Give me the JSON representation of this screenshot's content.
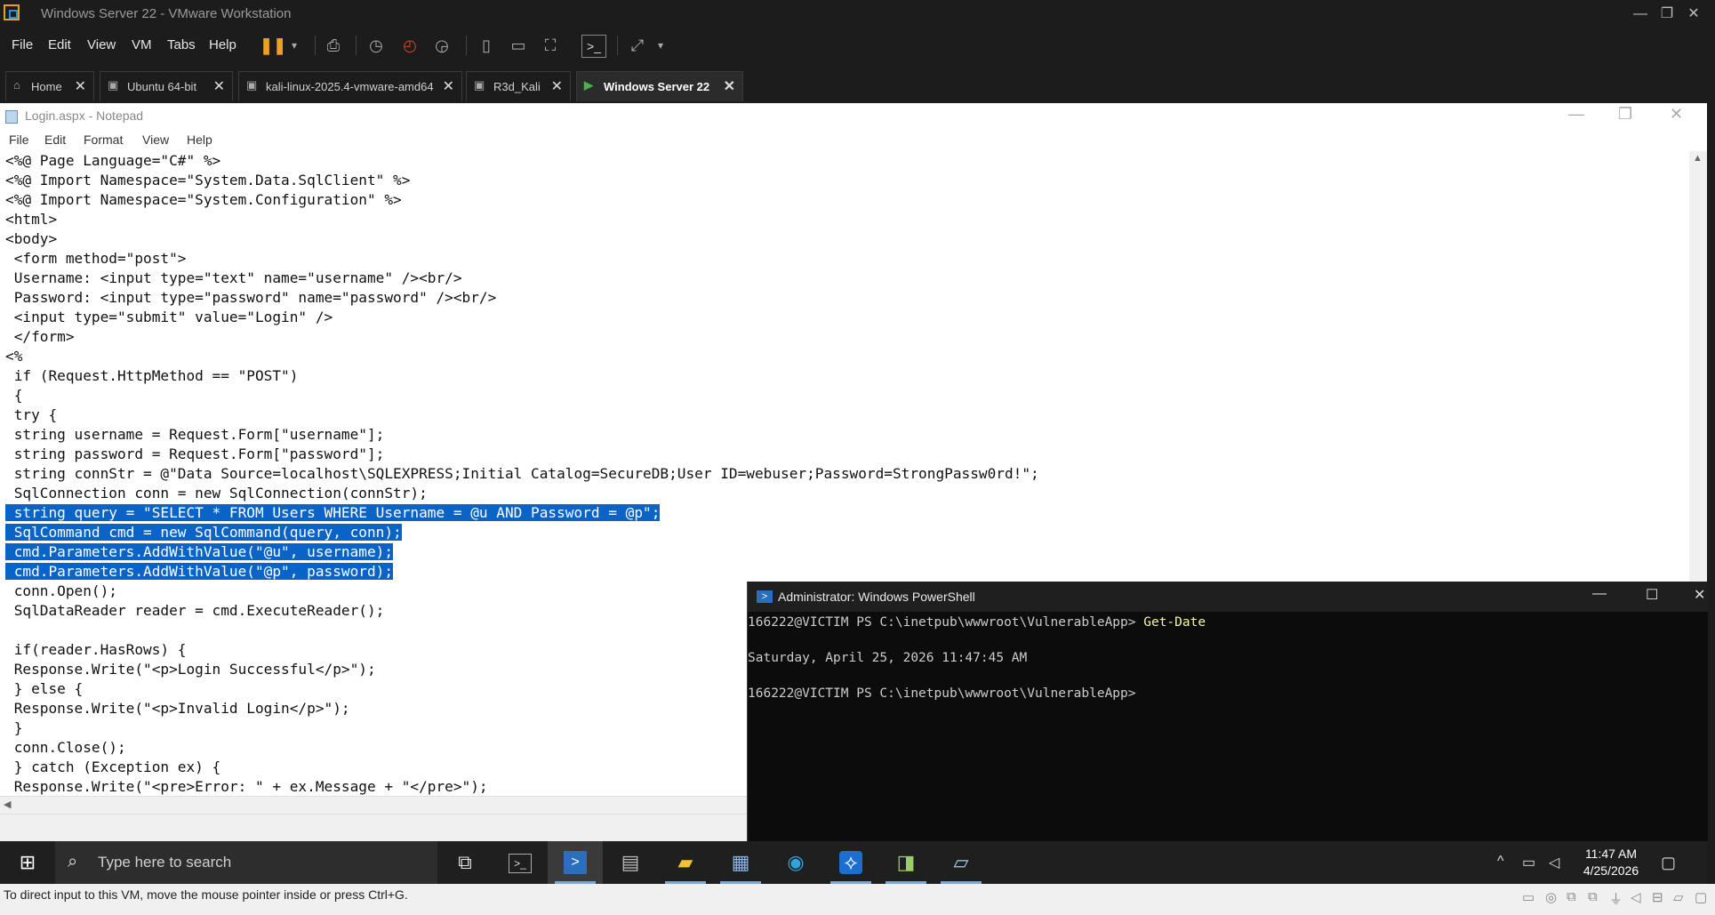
{
  "vmware": {
    "window_title": "Windows Server 22 - VMware Workstation",
    "menu": [
      "File",
      "Edit",
      "View",
      "VM",
      "Tabs",
      "Help"
    ],
    "tabs": [
      {
        "label": "Home",
        "icon": "home-icon"
      },
      {
        "label": "Ubuntu 64-bit",
        "icon": "vm-icon"
      },
      {
        "label": "kali-linux-2025.4-vmware-amd64",
        "icon": "vm-icon"
      },
      {
        "label": "R3d_Kali",
        "icon": "vm-icon"
      },
      {
        "label": "Windows Server 22",
        "icon": "vm-running-icon",
        "active": true
      }
    ],
    "status_text": "To direct input to this VM, move the mouse pointer inside or press Ctrl+G."
  },
  "notepad": {
    "title": "Login.aspx - Notepad",
    "menu": [
      "File",
      "Edit",
      "Format",
      "View",
      "Help"
    ],
    "lines": [
      "<%@ Page Language=\"C#\" %>",
      "<%@ Import Namespace=\"System.Data.SqlClient\" %>",
      "<%@ Import Namespace=\"System.Configuration\" %>",
      "<html>",
      "<body>",
      " <form method=\"post\">",
      " Username: <input type=\"text\" name=\"username\" /><br/>",
      " Password: <input type=\"password\" name=\"password\" /><br/>",
      " <input type=\"submit\" value=\"Login\" />",
      " </form>",
      "<%",
      " if (Request.HttpMethod == \"POST\")",
      " {",
      " try {",
      " string username = Request.Form[\"username\"];",
      " string password = Request.Form[\"password\"];",
      " string connStr = @\"Data Source=localhost\\SQLEXPRESS;Initial Catalog=SecureDB;User ID=webuser;Password=StrongPassw0rd!\";",
      " SqlConnection conn = new SqlConnection(connStr);",
      " string query = \"SELECT * FROM Users WHERE Username = @u AND Password = @p\";",
      " SqlCommand cmd = new SqlCommand(query, conn);",
      " cmd.Parameters.AddWithValue(\"@u\", username);",
      " cmd.Parameters.AddWithValue(\"@p\", password);",
      " conn.Open();",
      " SqlDataReader reader = cmd.ExecuteReader();",
      "",
      " if(reader.HasRows) {",
      " Response.Write(\"<p>Login Successful</p>\");",
      " } else {",
      " Response.Write(\"<p>Invalid Login</p>\");",
      " }",
      " conn.Close();",
      " } catch (Exception ex) {",
      " Response.Write(\"<pre>Error: \" + ex.Message + \"</pre>\");"
    ],
    "selected_lines": [
      18,
      19,
      20,
      21
    ]
  },
  "powershell": {
    "title": "Administrator: Windows PowerShell",
    "prompt1": "166222@VICTIM PS C:\\inetpub\\wwwroot\\VulnerableApp>",
    "command1": "Get-Date",
    "output": "Saturday, April 25, 2026 11:47:45 AM",
    "prompt2": "166222@VICTIM PS C:\\inetpub\\wwwroot\\VulnerableApp>"
  },
  "taskbar": {
    "search_placeholder": "Type here to search",
    "time": "11:47 AM",
    "date": "4/25/2026"
  }
}
